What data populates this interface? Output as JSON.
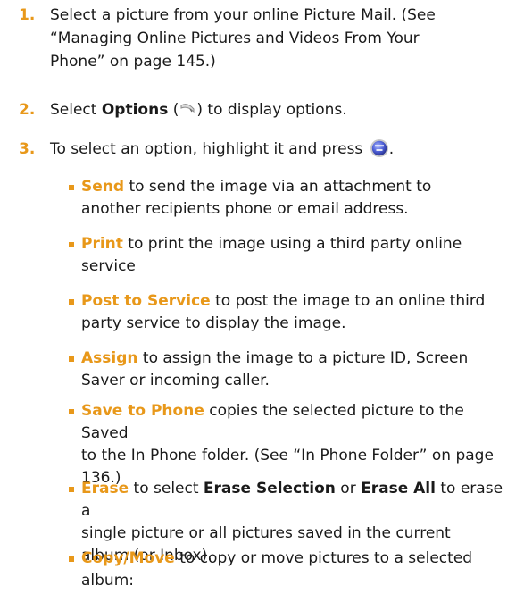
{
  "colors": {
    "accent": "#e8981a",
    "text": "#1a1a1a"
  },
  "steps": [
    {
      "number": "1.",
      "line1": "Select a picture from your online Picture Mail. (See",
      "line2": "“Managing Online Pictures and Videos From Your",
      "line3": "Phone” on page 145.)"
    },
    {
      "number": "2.",
      "pre": "Select ",
      "bold": "Options",
      "mid": " (",
      "icon": "right-softkey-icon",
      "post": ") to display options."
    },
    {
      "number": "3.",
      "pre": "To select an option, highlight it and press ",
      "icon": "menu-ok-key-icon",
      "post": "."
    }
  ],
  "bullets": [
    {
      "lead": "Send",
      "lines": [
        " to send the image via an attachment to",
        "another recipients phone or email address."
      ]
    },
    {
      "lead": "Print",
      "lines": [
        " to print the image using a third party online",
        "service"
      ]
    },
    {
      "lead": "Post to Service",
      "lines": [
        " to post the image to an online third",
        "party service to display the image."
      ]
    },
    {
      "lead": "Assign",
      "lines": [
        " to assign the image to a picture ID, Screen",
        "Saver or incoming caller."
      ]
    },
    {
      "lead": "Save to Phone",
      "lines": [
        " copies the selected picture to the Saved",
        "to the In Phone folder. (See “In Phone Folder” on page",
        "136.)"
      ]
    },
    {
      "lead": "Erase",
      "mid1": " to select ",
      "bold1": "Erase Selection",
      "mid2": " or ",
      "bold2": "Erase All",
      "mid3": " to erase a",
      "lines2": [
        "single picture or all pictures saved in the current",
        "album (or Inbox)."
      ]
    },
    {
      "lead": "Copy/Move",
      "lines": [
        " to copy or move pictures to a selected",
        "album:"
      ]
    }
  ]
}
